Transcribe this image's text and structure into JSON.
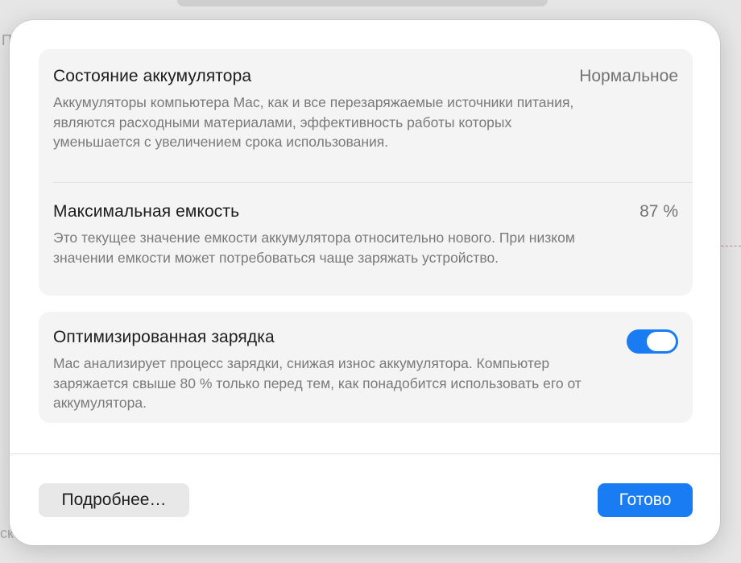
{
  "battery_state": {
    "title": "Состояние аккумулятора",
    "value": "Нормальное",
    "description": "Аккумуляторы компьютера Mac, как и все перезаряжаемые источники питания, являются расходными материалами, эффективность работы которых уменьшается с увеличением срока использования."
  },
  "max_capacity": {
    "title": "Максимальная емкость",
    "value": "87 %",
    "description": "Это текущее значение емкости аккумулятора относительно нового. При низком значении емкости может потребоваться чаще заряжать устройство."
  },
  "optimized_charging": {
    "title": "Оптимизированная зарядка",
    "enabled": true,
    "description": "Mac анализирует процесс зарядки, снижая износ аккумулятора. Компьютер заряжается свыше 80 % только перед тем, как понадобится использовать его от аккумулятора."
  },
  "buttons": {
    "more": "Подробнее…",
    "done": "Готово"
  },
  "colors": {
    "accent": "#1a7cf2"
  }
}
